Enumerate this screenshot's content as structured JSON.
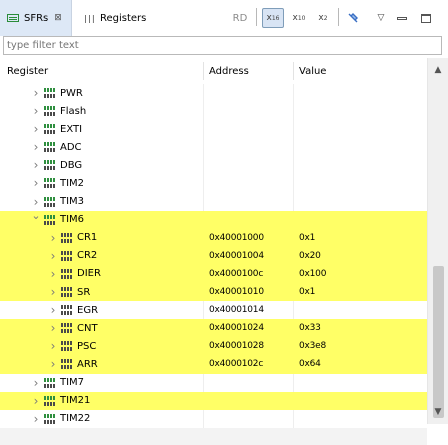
{
  "tabs": [
    {
      "label": "SFRs",
      "close": "⊠",
      "active": true
    },
    {
      "label": "Registers",
      "active": false
    }
  ],
  "toolbar": {
    "rd": "RD",
    "x16": "x",
    "x16_sub": "16",
    "x10": "x",
    "x10_sub": "10",
    "x2": "x",
    "x2_sub": "2",
    "pin_icon": "pin-icon",
    "menu": "▽",
    "selected_format": "x16"
  },
  "filter": {
    "placeholder": "type filter text",
    "value": ""
  },
  "columns": {
    "register": "Register",
    "address": "Address",
    "value": "Value"
  },
  "rows": [
    {
      "name": "PWR",
      "level": 1,
      "expanded": false,
      "highlight": false,
      "address": "",
      "value": ""
    },
    {
      "name": "Flash",
      "level": 1,
      "expanded": false,
      "highlight": false,
      "address": "",
      "value": ""
    },
    {
      "name": "EXTI",
      "level": 1,
      "expanded": false,
      "highlight": false,
      "address": "",
      "value": ""
    },
    {
      "name": "ADC",
      "level": 1,
      "expanded": false,
      "highlight": false,
      "address": "",
      "value": ""
    },
    {
      "name": "DBG",
      "level": 1,
      "expanded": false,
      "highlight": false,
      "address": "",
      "value": ""
    },
    {
      "name": "TIM2",
      "level": 1,
      "expanded": false,
      "highlight": false,
      "address": "",
      "value": ""
    },
    {
      "name": "TIM3",
      "level": 1,
      "expanded": false,
      "highlight": false,
      "address": "",
      "value": ""
    },
    {
      "name": "TIM6",
      "level": 1,
      "expanded": true,
      "highlight": true,
      "address": "",
      "value": ""
    },
    {
      "name": "CR1",
      "level": 2,
      "expanded": false,
      "highlight": true,
      "address": "0x40001000",
      "value": "0x1"
    },
    {
      "name": "CR2",
      "level": 2,
      "expanded": false,
      "highlight": true,
      "address": "0x40001004",
      "value": "0x20"
    },
    {
      "name": "DIER",
      "level": 2,
      "expanded": false,
      "highlight": true,
      "address": "0x4000100c",
      "value": "0x100"
    },
    {
      "name": "SR",
      "level": 2,
      "expanded": false,
      "highlight": true,
      "address": "0x40001010",
      "value": "0x1"
    },
    {
      "name": "EGR",
      "level": 2,
      "expanded": false,
      "highlight": false,
      "address": "0x40001014",
      "value": ""
    },
    {
      "name": "CNT",
      "level": 2,
      "expanded": false,
      "highlight": true,
      "address": "0x40001024",
      "value": "0x33"
    },
    {
      "name": "PSC",
      "level": 2,
      "expanded": false,
      "highlight": true,
      "address": "0x40001028",
      "value": "0x3e8"
    },
    {
      "name": "ARR",
      "level": 2,
      "expanded": false,
      "highlight": true,
      "address": "0x4000102c",
      "value": "0x64"
    },
    {
      "name": "TIM7",
      "level": 1,
      "expanded": false,
      "highlight": false,
      "address": "",
      "value": ""
    },
    {
      "name": "TIM21",
      "level": 1,
      "expanded": false,
      "highlight": true,
      "address": "",
      "value": ""
    },
    {
      "name": "TIM22",
      "level": 1,
      "expanded": false,
      "highlight": false,
      "address": "",
      "value": ""
    }
  ],
  "colors": {
    "highlight": "#ffff66",
    "tab_active": "#dde8f6",
    "toolbar_pressed": "#d8e4f4"
  }
}
